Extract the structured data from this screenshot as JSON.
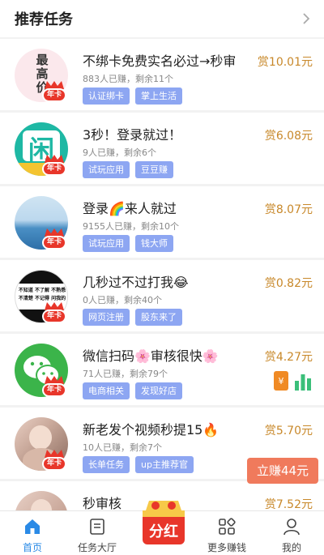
{
  "header": {
    "title": "推荐任务"
  },
  "badge_label": "年卡",
  "tasks": [
    {
      "title": "不绑卡免费实名必过→秒审",
      "done": "883人已赚，剩余11个",
      "tags": [
        "认证绑卡",
        "掌上生活"
      ],
      "reward": "赏10.01元",
      "avatar_text": "最\n高\n价"
    },
    {
      "title": "3秒！登录就过！",
      "done": "9人已赚，剩余6个",
      "tags": [
        "试玩应用",
        "豆豆赚"
      ],
      "reward": "赏6.08元",
      "avatar_text": "闲"
    },
    {
      "title": "登录🌈来人就过",
      "done": "9155人已赚，剩余10个",
      "tags": [
        "试玩应用",
        "钱大师"
      ],
      "reward": "赏8.07元"
    },
    {
      "title": "几秒过不过打我😂",
      "done": "0人已赚，剩余40个",
      "tags": [
        "网页注册",
        "股东来了"
      ],
      "reward": "赏0.82元",
      "avatar_text": "不知道 不了解 不熟悉\n不清楚 不记得 问我的"
    },
    {
      "title": "微信扫码🌸审核很快🌸",
      "done": "71人已赚，剩余79个",
      "tags": [
        "电商相关",
        "发现好店"
      ],
      "reward": "赏4.27元"
    },
    {
      "title": "新老发个视频秒提15🔥",
      "done": "10人已赚，剩余7个",
      "tags": [
        "长单任务",
        "up主推荐官"
      ],
      "reward": "赏5.70元"
    },
    {
      "title": "秒审核",
      "done": "",
      "tags": [],
      "reward": "赏7.52元"
    }
  ],
  "quick_earn": "立赚44元",
  "fenhong": "分红",
  "nav": [
    {
      "label": "首页",
      "icon": "home-icon",
      "active": true
    },
    {
      "label": "任务大厅",
      "icon": "task-hall-icon"
    },
    {
      "label": "",
      "icon": "dividend-icon"
    },
    {
      "label": "更多赚钱",
      "icon": "grid-icon"
    },
    {
      "label": "我的",
      "icon": "user-icon"
    }
  ],
  "colors": {
    "accent": "#2a8ae6",
    "reward": "#c8882a",
    "tag": "#8da6f2",
    "quick_earn": "#f07a5c"
  }
}
